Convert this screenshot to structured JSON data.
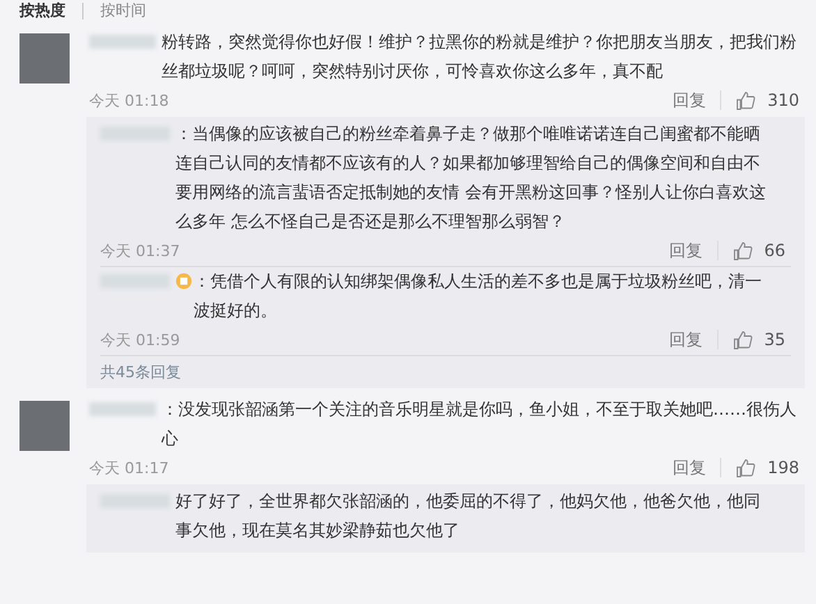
{
  "sort_tabs": [
    {
      "label": "按热度",
      "selected": true
    },
    {
      "label": "按时间",
      "selected": false
    }
  ],
  "comments": [
    {
      "text": "粉转路，突然觉得你也好假！维护？拉黑你的粉就是维护？你把朋友当朋友，把我们粉丝都垃圾呢？呵呵，突然特别讨厌你，可怜喜欢你这么多年，真不配",
      "time": "今天 01:18",
      "reply_label": "回复",
      "likes": "310",
      "replies": [
        {
          "badge": false,
          "text": "：当偶像的应该被自己的粉丝牵着鼻子走？做那个唯唯诺诺连自己闺蜜都不能晒连自己认同的友情都不应该有的人？如果都加够理智给自己的偶像空间和自由不要用网络的流言蜚语否定抵制她的友情 会有开黑粉这回事？怪别人让你白喜欢这么多年 怎么不怪自己是否还是那么不理智那么弱智？",
          "time": "今天 01:37",
          "reply_label": "回复",
          "likes": "66"
        },
        {
          "badge": true,
          "text": "：凭借个人有限的认知绑架偶像私人生活的差不多也是属于垃圾粉丝吧，清一波挺好的。",
          "time": "今天 01:59",
          "reply_label": "回复",
          "likes": "35"
        }
      ],
      "more_replies": "共45条回复"
    },
    {
      "text": "：没发现张韶涵第一个关注的音乐明星就是你吗，鱼小姐，不至于取关她吧……很伤人心",
      "time": "今天 01:17",
      "reply_label": "回复",
      "likes": "198",
      "replies": [
        {
          "badge": false,
          "text": "好了好了，全世界都欠张韶涵的，他委屈的不得了，他妈欠他，他爸欠他，他同事欠他，现在莫名其妙梁静茹也欠他了"
        }
      ]
    }
  ]
}
